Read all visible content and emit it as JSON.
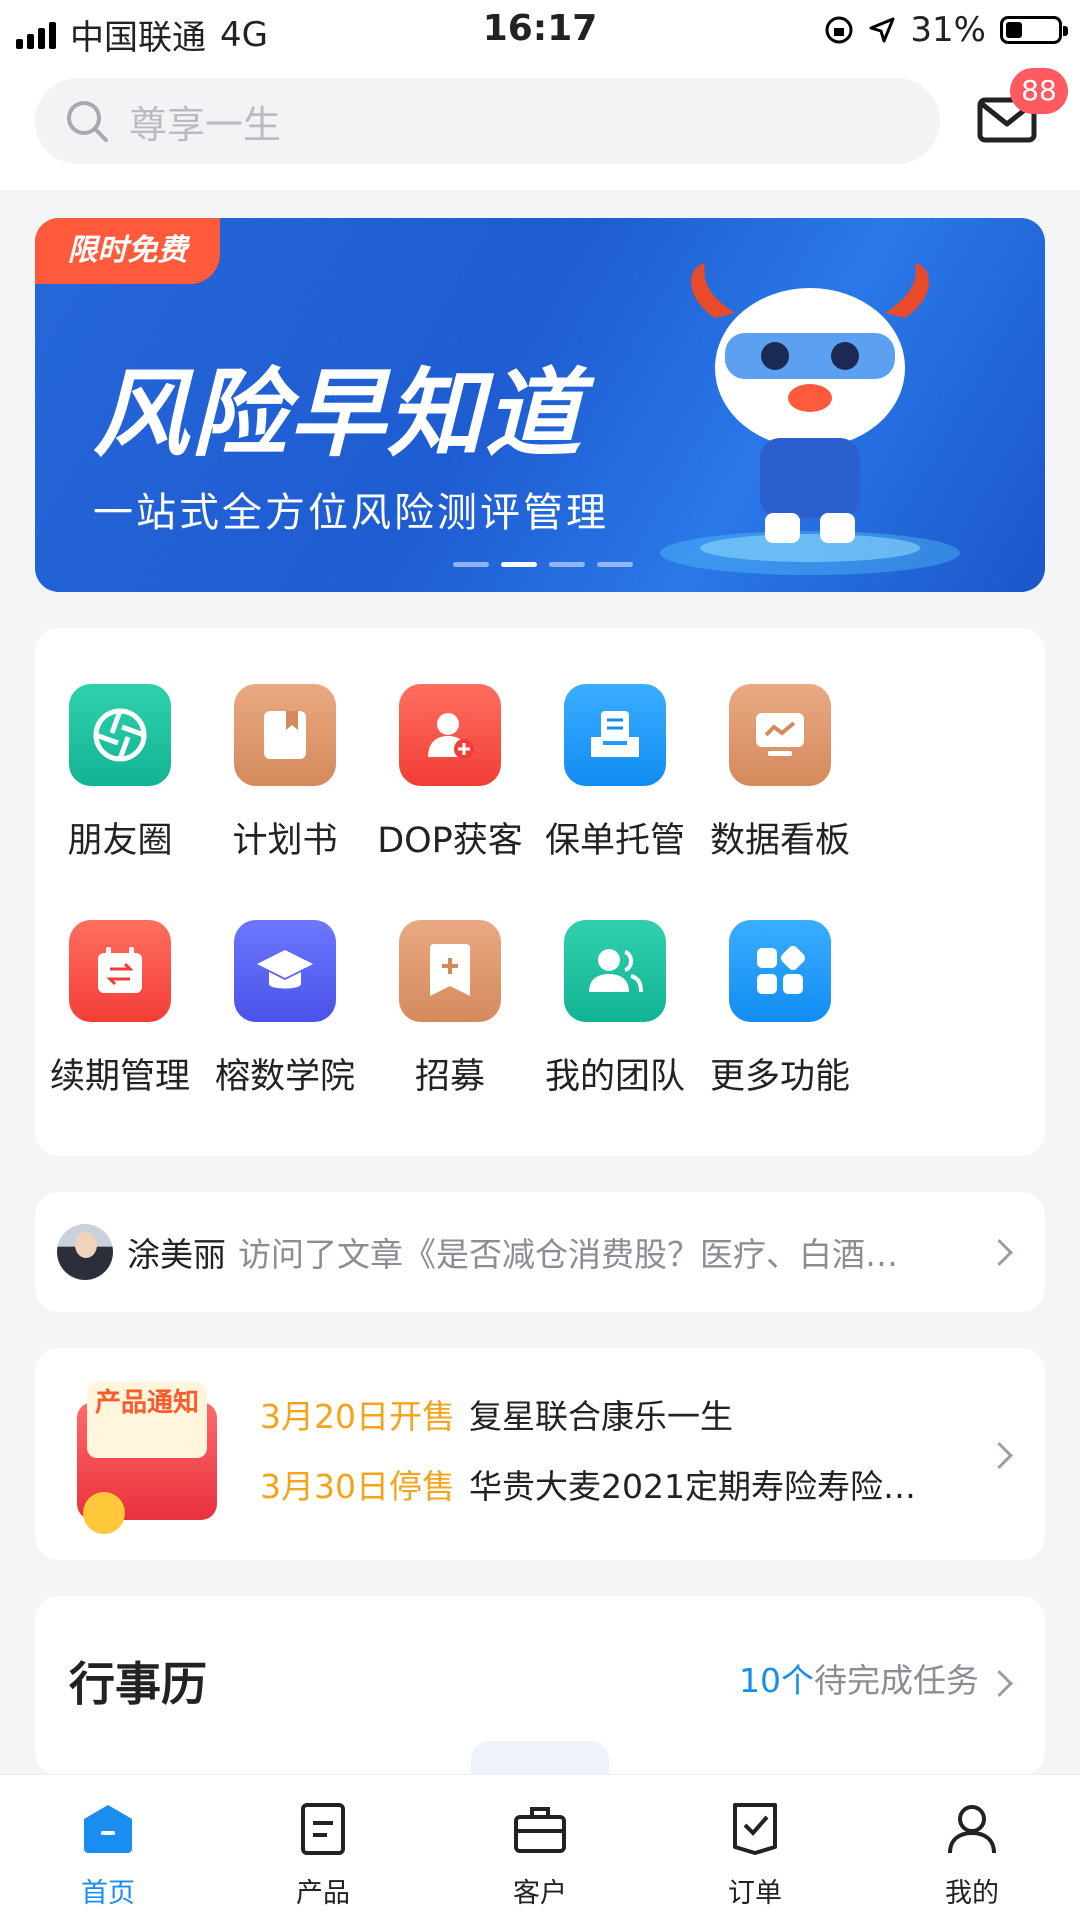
{
  "status_bar": {
    "carrier": "中国联通",
    "network": "4G",
    "time": "16:17",
    "battery": "31%"
  },
  "header": {
    "search_placeholder": "尊享一生",
    "mail_badge": "88"
  },
  "banner": {
    "tag": "限时免费",
    "title": "风险早知道",
    "subtitle": "一站式全方位风险测评管理",
    "slides": 4,
    "active_slide": 2
  },
  "functions": [
    {
      "label": "朋友圈",
      "icon": "aperture-icon"
    },
    {
      "label": "计划书",
      "icon": "book-icon"
    },
    {
      "label": "DOP获客",
      "icon": "add-user-icon"
    },
    {
      "label": "保单托管",
      "icon": "tray-icon"
    },
    {
      "label": "数据看板",
      "icon": "dashboard-icon"
    },
    {
      "label": "续期管理",
      "icon": "calendar-swap-icon"
    },
    {
      "label": "榕数学院",
      "icon": "graduation-cap-icon"
    },
    {
      "label": "招募",
      "icon": "bookmark-plus-icon"
    },
    {
      "label": "我的团队",
      "icon": "team-icon"
    },
    {
      "label": "更多功能",
      "icon": "apps-icon"
    }
  ],
  "activity": {
    "name": "涂美丽",
    "text": "访问了文章《是否减仓消费股？医疗、白酒…"
  },
  "notice": {
    "badge": "产品通知",
    "items": [
      {
        "date": "3月20日开售",
        "product": "复星联合康乐一生"
      },
      {
        "date": "3月30日停售",
        "product": "华贵大麦2021定期寿险寿险…"
      }
    ]
  },
  "calendar": {
    "title": "行事历",
    "task_count": "10个",
    "task_text": "待完成任务"
  },
  "tabs": [
    {
      "label": "首页",
      "active": true
    },
    {
      "label": "产品",
      "active": false
    },
    {
      "label": "客户",
      "active": false
    },
    {
      "label": "订单",
      "active": false
    },
    {
      "label": "我的",
      "active": false
    }
  ],
  "colors": {
    "accent": "#1a8df0",
    "badge": "#ff5a5f",
    "notice_date": "#f5a31a"
  }
}
